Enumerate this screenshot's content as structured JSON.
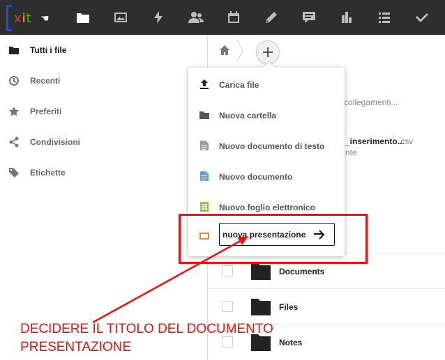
{
  "topbar": {
    "logo_text": "xit",
    "icons": [
      {
        "name": "files-icon",
        "active": true
      },
      {
        "name": "gallery-icon",
        "active": false
      },
      {
        "name": "activity-icon",
        "active": false
      },
      {
        "name": "contacts-icon",
        "active": false
      },
      {
        "name": "calendar-icon",
        "active": false
      },
      {
        "name": "notes-icon",
        "active": false
      },
      {
        "name": "talk-icon",
        "active": false
      },
      {
        "name": "analytics-icon",
        "active": false
      },
      {
        "name": "list-icon",
        "active": false
      },
      {
        "name": "tasks-icon",
        "active": false
      }
    ]
  },
  "sidebar": {
    "items": [
      {
        "label": "Tutti i file",
        "icon": "folder-icon",
        "active": true
      },
      {
        "label": "Recenti",
        "icon": "clock-icon",
        "active": false
      },
      {
        "label": "Preferiti",
        "icon": "star-icon",
        "active": false
      },
      {
        "label": "Condivisioni",
        "icon": "share-icon",
        "active": false
      },
      {
        "label": "Etichette",
        "icon": "tag-icon",
        "active": false
      }
    ]
  },
  "main": {
    "background_texts": {
      "links": "collegamenti...",
      "file_name": "_inserimentо...",
      "file_ext": ".csv",
      "file_sub": "nte"
    },
    "rows": [
      {
        "name": "Documents"
      },
      {
        "name": "Files"
      },
      {
        "name": "Notes"
      }
    ]
  },
  "menu": {
    "items": [
      {
        "label": "Carica file",
        "icon": "upload-icon",
        "color": "#222222"
      },
      {
        "label": "Nuova cartella",
        "icon": "folder-icon",
        "color": "#555555"
      },
      {
        "label": "Nuovo documento di testo",
        "icon": "text-file-icon",
        "color": "#9a9a9a"
      },
      {
        "label": "Nuovo documento",
        "icon": "document-icon",
        "color": "#5aa8d9"
      },
      {
        "label": "Nuovo foglio elettronico",
        "icon": "spreadsheet-icon",
        "color": "#8fbf4a"
      }
    ],
    "input_value": "nuova presentazione",
    "input_icon": "presentation-icon",
    "input_icon_color": "#e28a32"
  },
  "annotation": {
    "line1": "DECIDERE IL TITOLO DEL DOCUMENTO",
    "line2": "PRESENTAZIONE",
    "color": "#ee1111"
  }
}
